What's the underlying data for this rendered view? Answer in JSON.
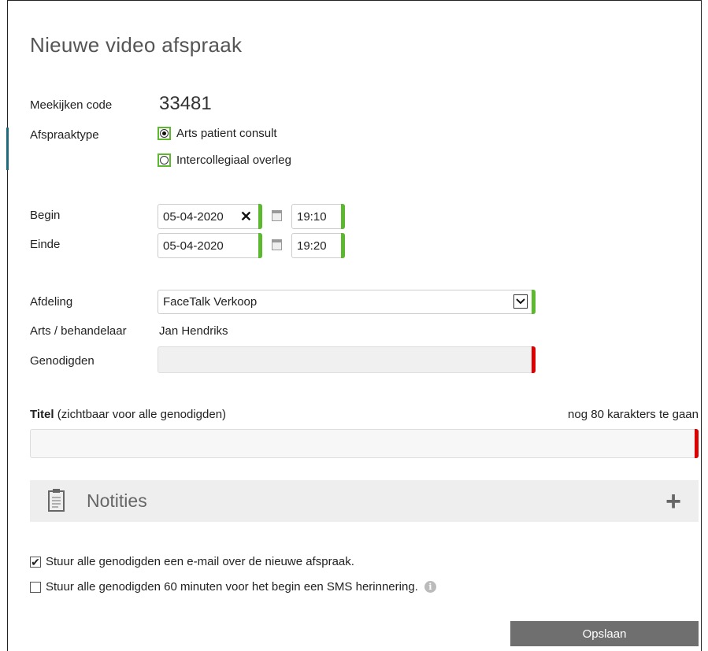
{
  "dialog": {
    "title": "Nieuwe video afspraak"
  },
  "meekijken": {
    "label": "Meekijken code",
    "value": "33481"
  },
  "afspraaktype": {
    "label": "Afspraaktype",
    "options": [
      {
        "label": "Arts patient consult",
        "selected": true
      },
      {
        "label": "Intercollegiaal overleg",
        "selected": false
      }
    ]
  },
  "begin": {
    "label": "Begin",
    "date": "05-04-2020",
    "clear": "✕",
    "time": "19:10"
  },
  "einde": {
    "label": "Einde",
    "date": "05-04-2020",
    "time": "19:20"
  },
  "afdeling": {
    "label": "Afdeling",
    "value": "FaceTalk Verkoop"
  },
  "arts": {
    "label": "Arts / behandelaar",
    "value": "Jan Hendriks"
  },
  "genodigden": {
    "label": "Genodigden",
    "value": ""
  },
  "titel": {
    "label_bold": "Titel",
    "label_rest": " (zichtbaar voor alle genodigden)",
    "counter": "nog 80 karakters te gaan",
    "value": ""
  },
  "notities": {
    "title": "Notities",
    "add": "+"
  },
  "options": {
    "email": {
      "label": "Stuur alle genodigden een e-mail over de nieuwe afspraak.",
      "checked": true
    },
    "sms": {
      "label": "Stuur alle genodigden 60 minuten voor het begin een SMS herinnering.",
      "checked": false
    }
  },
  "save_button": "Opslaan",
  "colors": {
    "valid": "#5cb82e",
    "invalid": "#dd0000",
    "button": "#6f6f6f"
  },
  "icons": [
    "clear-icon",
    "calendar-icon",
    "chevron-down-icon",
    "clipboard-icon",
    "plus-icon",
    "info-icon",
    "checkmark-icon"
  ]
}
